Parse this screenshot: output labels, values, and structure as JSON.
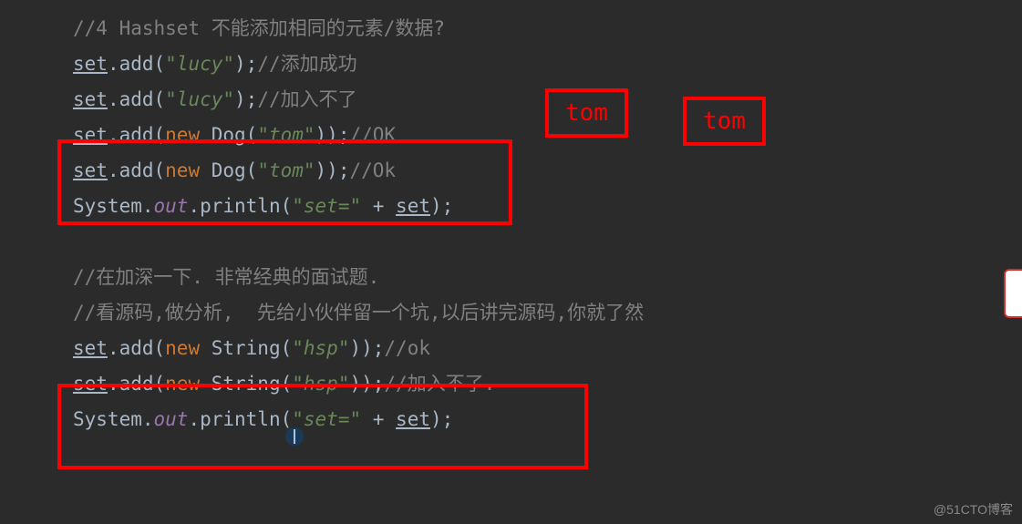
{
  "lines": {
    "l1_comment": "//4 Hashset 不能添加相同的元素/数据?",
    "l2_set": "set",
    "l2_add": ".add(",
    "l2_str": "\"lucy\"",
    "l2_close": ");",
    "l2_comment": "//添加成功",
    "l3_set": "set",
    "l3_add": ".add(",
    "l3_str": "\"lucy\"",
    "l3_close": ");",
    "l3_comment": "//加入不了",
    "l4_set": "set",
    "l4_add": ".add(",
    "l4_new": "new ",
    "l4_dog": "Dog(",
    "l4_str": "\"tom\"",
    "l4_close": "));",
    "l4_comment": "//OK",
    "l5_set": "set",
    "l5_add": ".add(",
    "l5_new": "new ",
    "l5_dog": "Dog(",
    "l5_str": "\"tom\"",
    "l5_close": "));",
    "l5_comment": "//Ok",
    "l6_sys": "System.",
    "l6_out": "out",
    "l6_println": ".println(",
    "l6_str": "\"set=\"",
    "l6_plus": " + ",
    "l6_set": "set",
    "l6_close": ");",
    "l8_comment": "//在加深一下. 非常经典的面试题.",
    "l9_comment": "//看源码,做分析,  先给小伙伴留一个坑,以后讲完源码,你就了然",
    "l10_set": "set",
    "l10_add": ".add(",
    "l10_new": "new ",
    "l10_string": "String(",
    "l10_str": "\"hsp\"",
    "l10_close": "));",
    "l10_comment": "//ok",
    "l11_set": "set",
    "l11_add": ".add(",
    "l11_new": "new ",
    "l11_string": "String(",
    "l11_str": "\"hsp\"",
    "l11_close": "));",
    "l11_comment": "//加入不了.",
    "l12_sys": "System.",
    "l12_out": "out",
    "l12_println": ".println(",
    "l12_str": "\"set=\"",
    "l12_plus": " + ",
    "l12_set": "set",
    "l12_close": ");"
  },
  "annotations": {
    "tom1": "tom",
    "tom2": "tom"
  },
  "watermark": "@51CTO博客"
}
